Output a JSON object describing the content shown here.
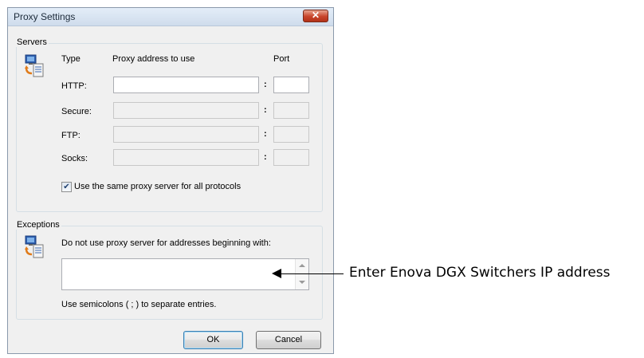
{
  "dialog": {
    "title": "Proxy Settings",
    "close_symbol": "✕"
  },
  "servers": {
    "group_label": "Servers",
    "icon": "network-computer-icon",
    "col_type": "Type",
    "col_address": "Proxy address to use",
    "col_port": "Port",
    "rows": [
      {
        "type": "HTTP:",
        "address": "",
        "port": "",
        "enabled": true
      },
      {
        "type": "Secure:",
        "address": "",
        "port": "",
        "enabled": false
      },
      {
        "type": "FTP:",
        "address": "",
        "port": "",
        "enabled": false
      },
      {
        "type": "Socks:",
        "address": "",
        "port": "",
        "enabled": false
      }
    ],
    "colon": ":",
    "same_proxy_label": "Use the same proxy server for all protocols",
    "same_proxy_checked": true,
    "check_mark": "✔"
  },
  "exceptions": {
    "group_label": "Exceptions",
    "icon": "network-computer-icon",
    "instruction": "Do not use proxy server for addresses beginning with:",
    "value": "",
    "hint": "Use semicolons ( ; ) to separate entries."
  },
  "buttons": {
    "ok": "OK",
    "cancel": "Cancel"
  },
  "annotation": {
    "callout": "Enter Enova DGX Switchers IP address"
  }
}
